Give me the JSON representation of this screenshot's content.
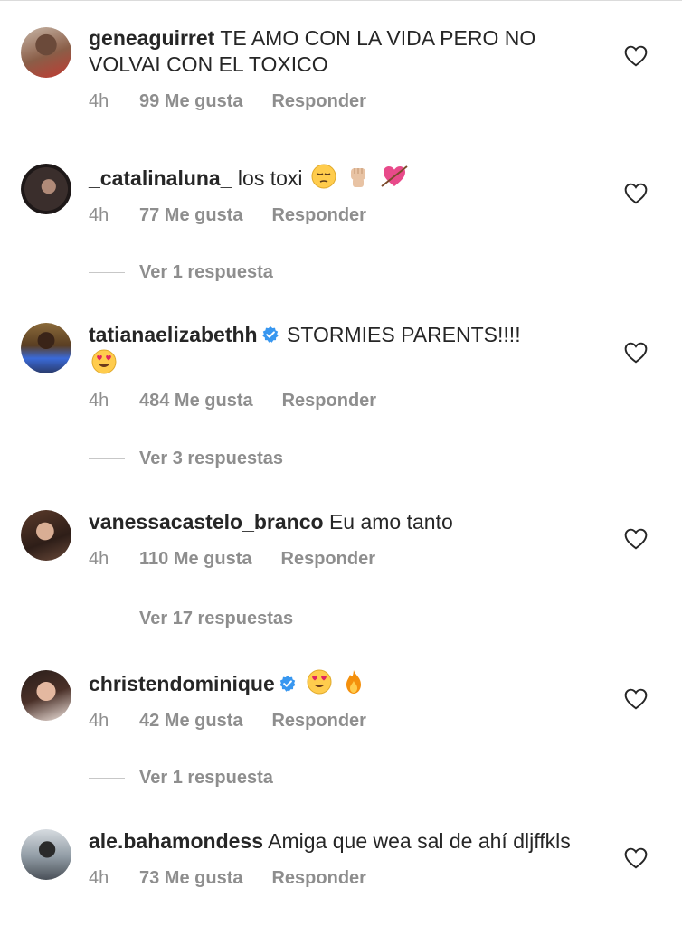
{
  "comments": [
    {
      "username": "geneaguirret",
      "text": "TE AMO CON LA VIDA PERO NO VOLVAI CON EL TOXICO",
      "time": "4h",
      "likes": "99 Me gusta",
      "reply": "Responder"
    },
    {
      "username": "_catalinaluna_",
      "text": "los toxi",
      "time": "4h",
      "likes": "77 Me gusta",
      "reply": "Responder",
      "replies": "Ver 1 respuesta"
    },
    {
      "username": "tatianaelizabethh",
      "text": "STORMIES PARENTS!!!!",
      "time": "4h",
      "likes": "484 Me gusta",
      "reply": "Responder",
      "replies": "Ver 3 respuestas"
    },
    {
      "username": "vanessacastelo_branco",
      "text": "Eu amo tanto",
      "time": "4h",
      "likes": "110 Me gusta",
      "reply": "Responder",
      "replies": "Ver 17 respuestas"
    },
    {
      "username": "christendominique",
      "text": "",
      "time": "4h",
      "likes": "42 Me gusta",
      "reply": "Responder",
      "replies": "Ver 1 respuesta"
    },
    {
      "username": "ale.bahamondess",
      "text": "Amiga que wea sal de ahí dljffkls",
      "time": "4h",
      "likes": "73 Me gusta",
      "reply": "Responder"
    }
  ],
  "icons": {
    "like": "heart-outline-icon",
    "verified": "verified-badge-icon"
  },
  "colors": {
    "text": "#262626",
    "secondary": "#8e8e8e",
    "verified": "#3897f0"
  }
}
